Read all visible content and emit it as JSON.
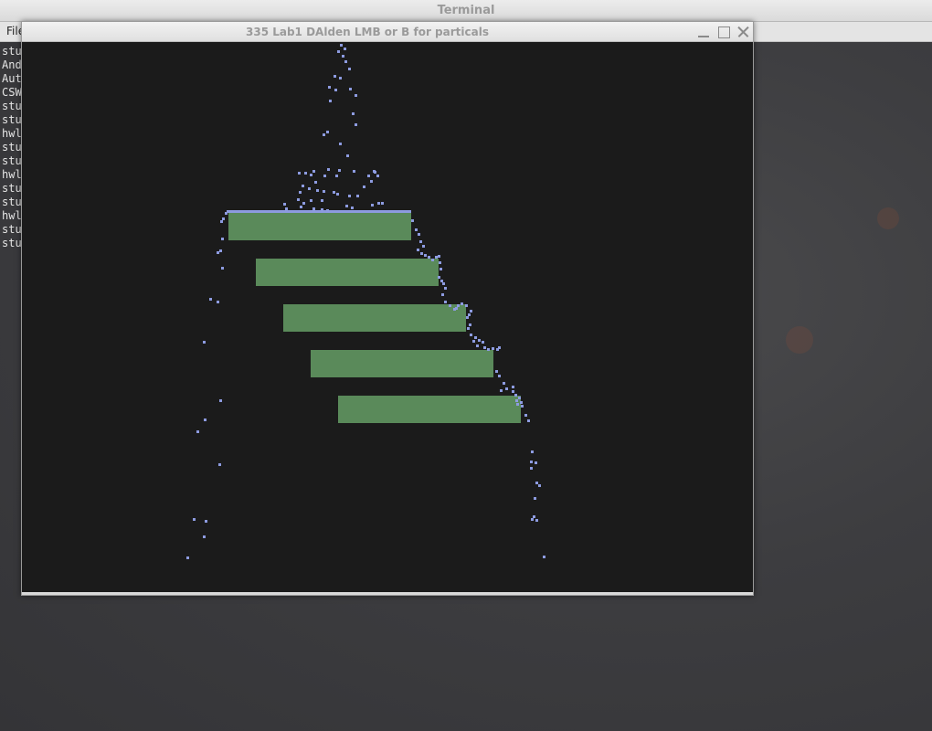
{
  "terminal": {
    "title": "Terminal",
    "menu_label": "File",
    "lines": [
      "stu",
      "And",
      "Aut",
      "CSW",
      "stu",
      "stu",
      "hwl",
      "stu",
      "stu",
      "hwl",
      "stu",
      "stu",
      "hwl",
      "stu",
      "stu"
    ]
  },
  "app": {
    "title": "335 Lab1 DAlden LMB or B for particals"
  },
  "colors": {
    "platform": "#5a8a5a",
    "particle": "#8d9be0",
    "canvas": "#1b1b1b"
  },
  "scene": {
    "platform_count": 5
  }
}
